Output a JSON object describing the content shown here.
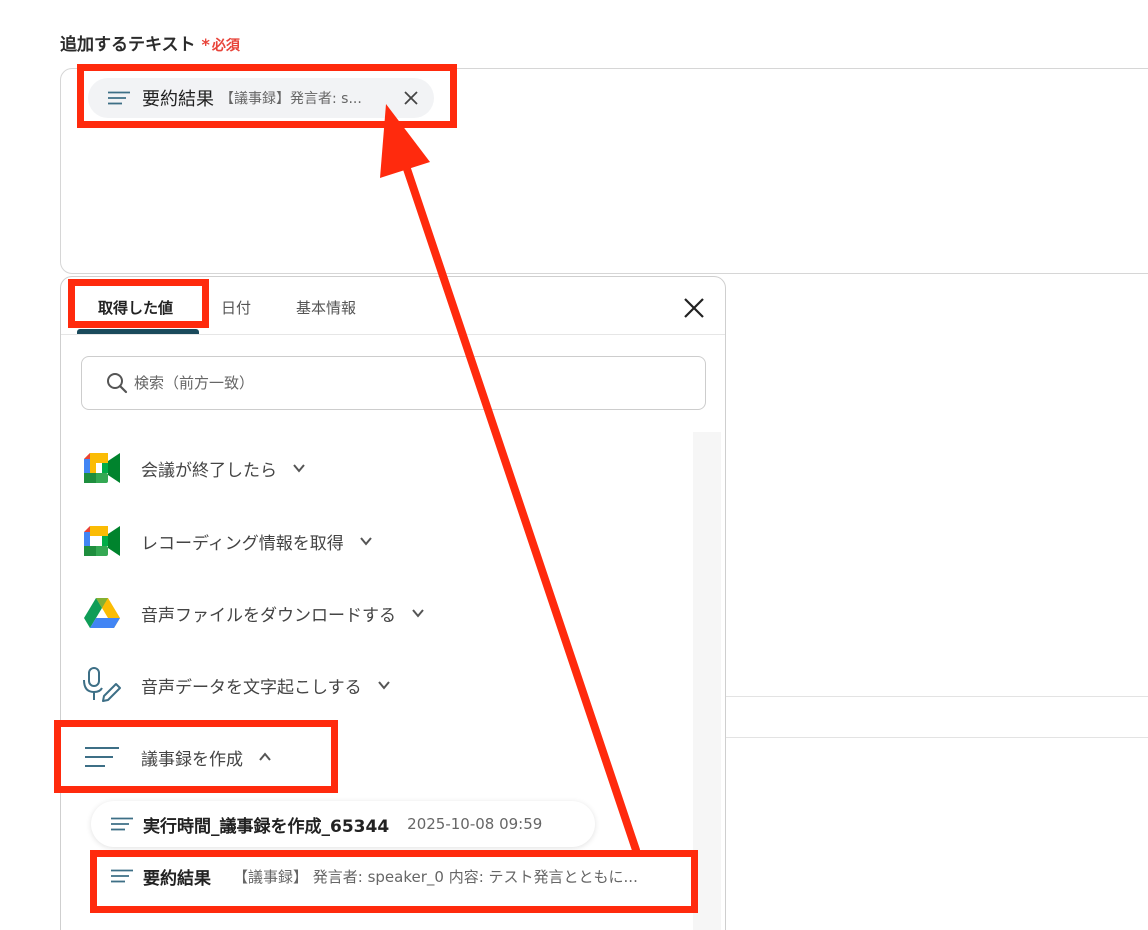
{
  "field": {
    "label": "追加するテキスト",
    "required_star": "*",
    "required_text": "必須"
  },
  "chip": {
    "icon": "lines-icon",
    "title": "要約結果",
    "preview": "【議事録】発言者: s...",
    "close_icon": "close-icon"
  },
  "panel": {
    "tabs": [
      {
        "label": "取得した値",
        "active": true
      },
      {
        "label": "日付",
        "active": false
      },
      {
        "label": "基本情報",
        "active": false
      }
    ],
    "search_placeholder": "検索（前方一致）",
    "steps": [
      {
        "label": "会議が終了したら",
        "icon": "google-meet-icon",
        "expanded": false
      },
      {
        "label": "レコーディング情報を取得",
        "icon": "google-meet-icon",
        "expanded": false
      },
      {
        "label": "音声ファイルをダウンロードする",
        "icon": "google-drive-icon",
        "expanded": false
      },
      {
        "label": "音声データを文字起こしする",
        "icon": "mic-pen-icon",
        "expanded": false
      },
      {
        "label": "議事録を作成",
        "icon": "lines-icon",
        "expanded": true
      }
    ],
    "sub_items": [
      {
        "title": "実行時間_議事録を作成_65344",
        "meta": "2025-10-08 09:59"
      },
      {
        "title": "要約結果",
        "meta": "【議事録】 発言者: speaker_0 内容: テスト発言とともに..."
      }
    ]
  },
  "colors": {
    "highlight": "#ff2a0d",
    "required": "#e8443a",
    "tab_underline": "#1a4a5c"
  }
}
